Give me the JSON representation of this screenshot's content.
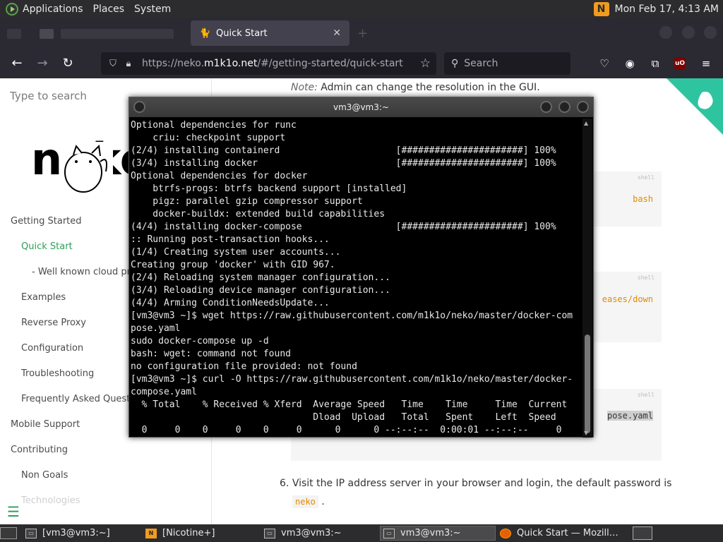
{
  "top_panel": {
    "menus": [
      "Applications",
      "Places",
      "System"
    ],
    "clock": "Mon Feb 17,  4:13 AM",
    "tray_app_letter": "N"
  },
  "browser": {
    "tab_title": "Quick Start",
    "url_host_prefix": "https://neko.",
    "url_host": "m1k1o.net",
    "url_path": "/#/getting-started/quick-start",
    "search_placeholder": "Search",
    "ublock_label": "uO"
  },
  "sidebar": {
    "search_placeholder": "Type to search",
    "logo_text": "neko",
    "items": [
      {
        "label": "Getting Started",
        "level": 0,
        "active": false
      },
      {
        "label": "Quick Start",
        "level": 1,
        "active": true
      },
      {
        "label": "- Well known cloud prov",
        "level": 2,
        "active": false
      },
      {
        "label": "Examples",
        "level": 1,
        "active": false
      },
      {
        "label": "Reverse Proxy",
        "level": 1,
        "active": false
      },
      {
        "label": "Configuration",
        "level": 1,
        "active": false
      },
      {
        "label": "Troubleshooting",
        "level": 1,
        "active": false
      },
      {
        "label": "Frequently Asked Questio",
        "level": 1,
        "active": false
      },
      {
        "label": "Mobile Support",
        "level": 0,
        "active": false
      },
      {
        "label": "Contributing",
        "level": 0,
        "active": false
      },
      {
        "label": "Non Goals",
        "level": 1,
        "active": false
      },
      {
        "label": "Technologies",
        "level": 1,
        "active": false
      }
    ]
  },
  "content": {
    "note_label": "Note:",
    "note_text": " Admin can change the resolution in the GUI.",
    "code_lang": "shell",
    "code_frag_1": "bash",
    "code_frag_2": "eases/down",
    "code_frag_3": "pose.yaml",
    "step6_num": "6.",
    "step6_text": "Visit the IP address server in your browser and login, the default password is",
    "step6_code": "neko",
    "step6_end": "."
  },
  "terminal": {
    "title": "vm3@vm3:~",
    "lines": [
      "Optional dependencies for runc",
      "    criu: checkpoint support",
      "(2/4) installing containerd                     [######################] 100%",
      "(3/4) installing docker                         [######################] 100%",
      "Optional dependencies for docker",
      "    btrfs-progs: btrfs backend support [installed]",
      "    pigz: parallel gzip compressor support",
      "    docker-buildx: extended build capabilities",
      "(4/4) installing docker-compose                 [######################] 100%",
      ":: Running post-transaction hooks...",
      "(1/4) Creating system user accounts...",
      "Creating group 'docker' with GID 967.",
      "(2/4) Reloading system manager configuration...",
      "(3/4) Reloading device manager configuration...",
      "(4/4) Arming ConditionNeedsUpdate...",
      "[vm3@vm3 ~]$ wget https://raw.githubusercontent.com/m1k1o/neko/master/docker-com",
      "pose.yaml",
      "sudo docker-compose up -d",
      "bash: wget: command not found",
      "no configuration file provided: not found",
      "[vm3@vm3 ~]$ curl -O https://raw.githubusercontent.com/m1k1o/neko/master/docker-",
      "compose.yaml",
      "  % Total    % Received % Xferd  Average Speed   Time    Time     Time  Current",
      "                                 Dload  Upload   Total   Spent    Left  Speed",
      "  0     0    0     0    0     0      0      0 --:--:--  0:00:01 --:--:--     0"
    ]
  },
  "taskbar": {
    "tasks": [
      {
        "label": "[vm3@vm3:~]",
        "icon": "terminal-icon",
        "active": false
      },
      {
        "label": "[Nicotine+]",
        "icon": "nicotine-icon",
        "active": false
      },
      {
        "label": "vm3@vm3:~",
        "icon": "terminal-icon",
        "active": false
      },
      {
        "label": "vm3@vm3:~",
        "icon": "terminal-icon",
        "active": true
      },
      {
        "label": "Quick Start — Mozill…",
        "icon": "firefox-icon",
        "active": false
      }
    ]
  }
}
